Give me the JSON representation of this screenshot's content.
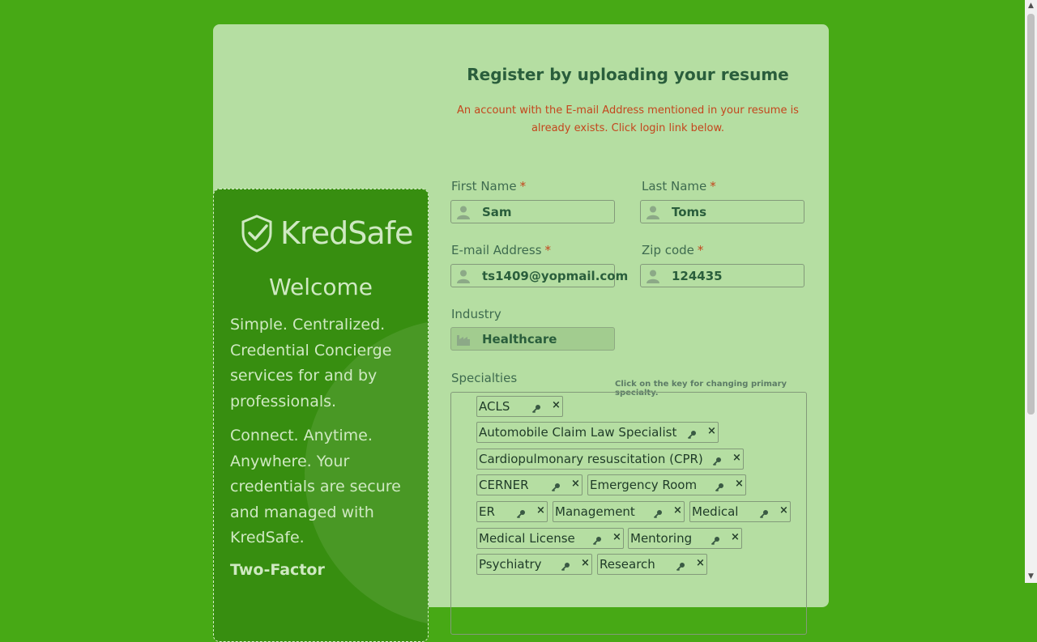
{
  "brand": {
    "name": "KredSafe"
  },
  "welcome": {
    "heading": "Welcome",
    "para1": "Simple. Centralized. Credential Concierge services for and by professionals.",
    "para2": "Connect. Anytime. Anywhere. Your credentials are secure and managed with KredSafe.",
    "section": "Two-Factor"
  },
  "form": {
    "title": "Register by uploading your resume",
    "error": "An account with the E-mail Address mentioned in your resume is already exists. Click login link below.",
    "required_mark": "*",
    "first_name": {
      "label": "First Name",
      "value": "Sam"
    },
    "last_name": {
      "label": "Last Name",
      "value": "Toms"
    },
    "email": {
      "label": "E-mail Address",
      "value": "ts1409@yopmail.com"
    },
    "zip": {
      "label": "Zip code",
      "value": "124435"
    },
    "industry": {
      "label": "Industry",
      "value": "Healthcare"
    },
    "specialties": {
      "label": "Specialties",
      "hint": "Click on the key for changing primary specialty.",
      "remove_symbol": "×",
      "tags": [
        "ACLS",
        "Automobile Claim Law Specialist",
        "Cardiopulmonary resuscitation (CPR)",
        "CERNER",
        "Emergency Room",
        "ER",
        "Management",
        "Medical",
        "Medical License",
        "Mentoring",
        "Psychiatry",
        "Research"
      ]
    }
  },
  "colors": {
    "page_bg": "#47a915",
    "card_bg": "#b5dea2",
    "panel_bg": "#378e10",
    "title": "#2a5e3c",
    "error": "#c4461d"
  },
  "icons": {
    "user": "user-icon",
    "industry": "factory-icon",
    "key": "key-icon",
    "remove": "close-icon",
    "logo": "shield-check-icon"
  }
}
